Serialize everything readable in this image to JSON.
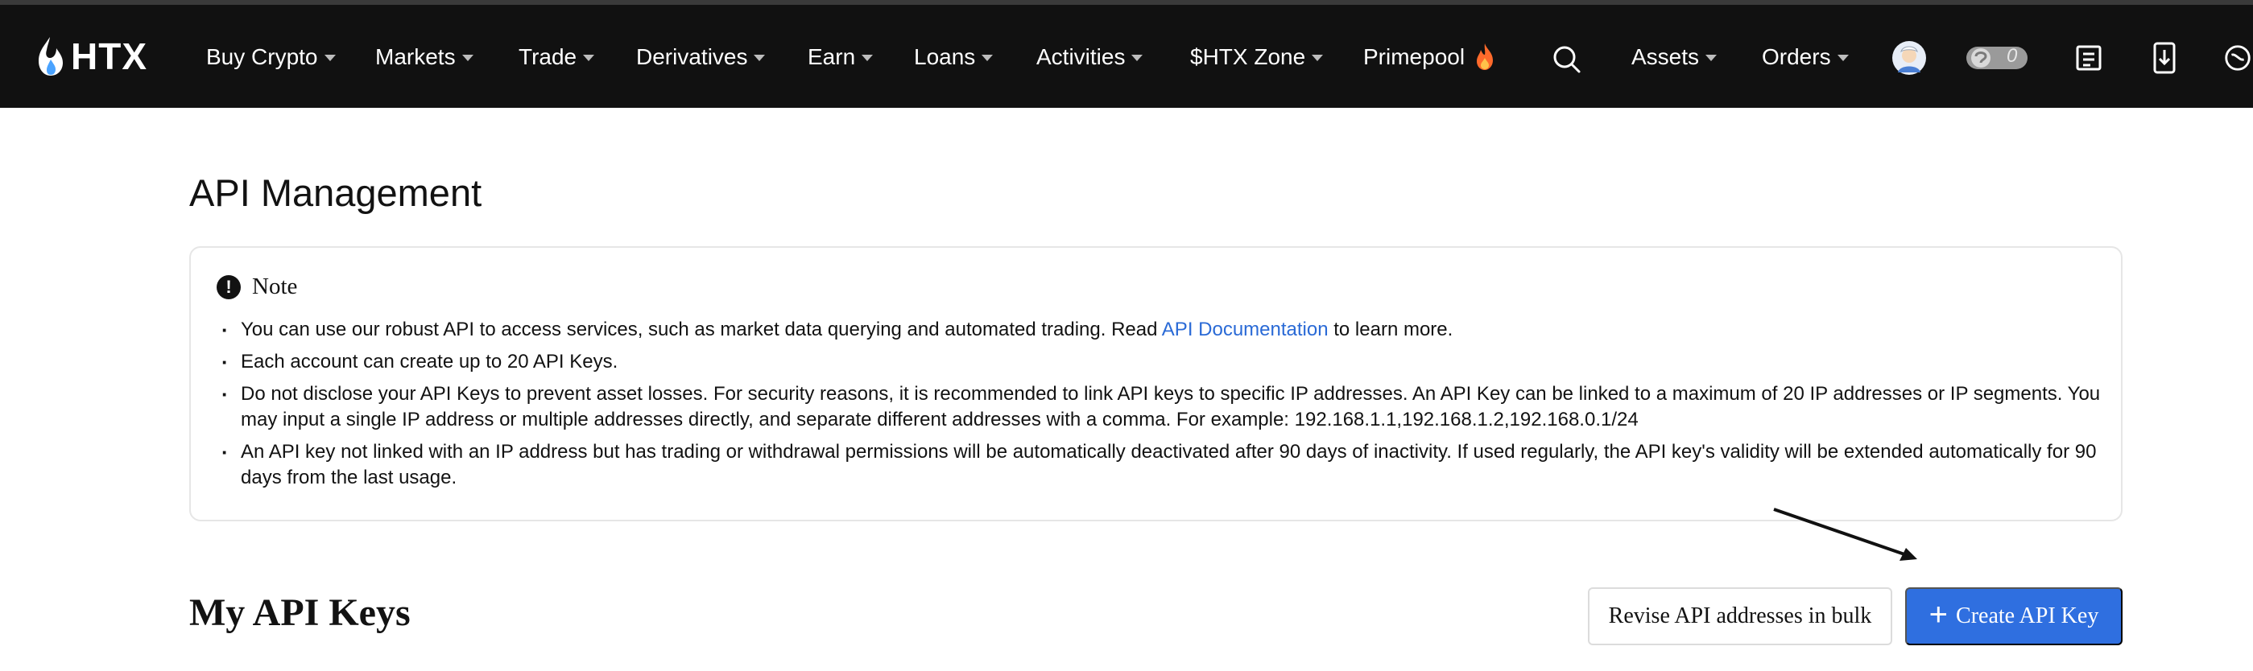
{
  "nav": {
    "logo_text": "HTX",
    "items": [
      {
        "label": "Buy Crypto"
      },
      {
        "label": "Markets"
      },
      {
        "label": "Trade"
      },
      {
        "label": "Derivatives"
      },
      {
        "label": "Earn"
      },
      {
        "label": "Loans"
      },
      {
        "label": "Activities"
      },
      {
        "label": "$HTX Zone"
      },
      {
        "label": "Primepool"
      }
    ],
    "assets_label": "Assets",
    "orders_label": "Orders",
    "toggle_count": "0"
  },
  "page": {
    "title": "API Management"
  },
  "note": {
    "title": "Note",
    "item1_prefix": "You can use our robust API to access services, such as market data querying and automated trading. Read ",
    "item1_link": "API Documentation",
    "item1_suffix": " to learn more.",
    "item2": "Each account can create up to 20 API Keys.",
    "item3": "Do not disclose your API Keys to prevent asset losses. For security reasons, it is recommended to link API keys to specific IP addresses. An API Key can be linked to a maximum of 20 IP addresses or IP segments. You may input a single IP address or multiple addresses directly, and separate different addresses with a comma. For example: 192.168.1.1,192.168.1.2,192.168.0.1/24",
    "item4": "An API key not linked with an IP address but has trading or withdrawal permissions will be automatically deactivated after 90 days of inactivity. If used regularly, the API key's validity will be extended automatically for 90 days from the last usage."
  },
  "keys": {
    "section_title": "My API Keys",
    "revise_label": "Revise API addresses in bulk",
    "create_label": "Create API Key"
  },
  "colors": {
    "nav_bg": "#111111",
    "primary": "#2f6fe0",
    "link": "#2a6ad6",
    "logo_flame": "#4aa3ff"
  }
}
